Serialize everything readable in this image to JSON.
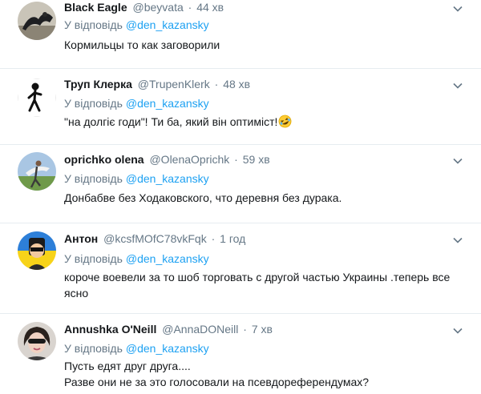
{
  "reply_prefix": "У відповідь",
  "tweets": [
    {
      "name": "Black Eagle",
      "handle": "@beyvata",
      "separator": "·",
      "time": "44 хв",
      "reply_to": "@den_kazansky",
      "lines": [
        "Кормильцы то как заговорили"
      ],
      "emoji": ""
    },
    {
      "name": "Труп Клерка",
      "handle": "@TrupenKlerk",
      "separator": "·",
      "time": "48 хв",
      "reply_to": "@den_kazansky",
      "lines": [
        "\"на долгіє годи\"! Ти ба, який він оптиміст!"
      ],
      "emoji": "rolling-on-floor-laughing-emoji"
    },
    {
      "name": "oprichko olena",
      "handle": "@OlenaOprichk",
      "separator": "·",
      "time": "59 хв",
      "reply_to": "@den_kazansky",
      "lines": [
        "Донбабве без Ходаковского, что деревня без дурака."
      ],
      "emoji": ""
    },
    {
      "name": "Антон",
      "handle": "@kcsfMOfC78vkFqk",
      "separator": "·",
      "time": "1 год",
      "reply_to": "@den_kazansky",
      "lines": [
        "короче воевели за то шоб торговать с другой частью Украины .теперь все",
        "ясно"
      ],
      "emoji": ""
    },
    {
      "name": "Annushka O'Neill",
      "handle": "@AnnaDONeill",
      "separator": "·",
      "time": "7 хв",
      "reply_to": "@den_kazansky",
      "lines": [
        "Пусть едят друг друга....",
        "Разве они не за это голосовали на псевдореферендумах?"
      ],
      "emoji": ""
    }
  ],
  "colors": {
    "text": "#14171a",
    "secondary": "#657786",
    "link": "#1da1f2",
    "divider": "#e6ecf0"
  }
}
